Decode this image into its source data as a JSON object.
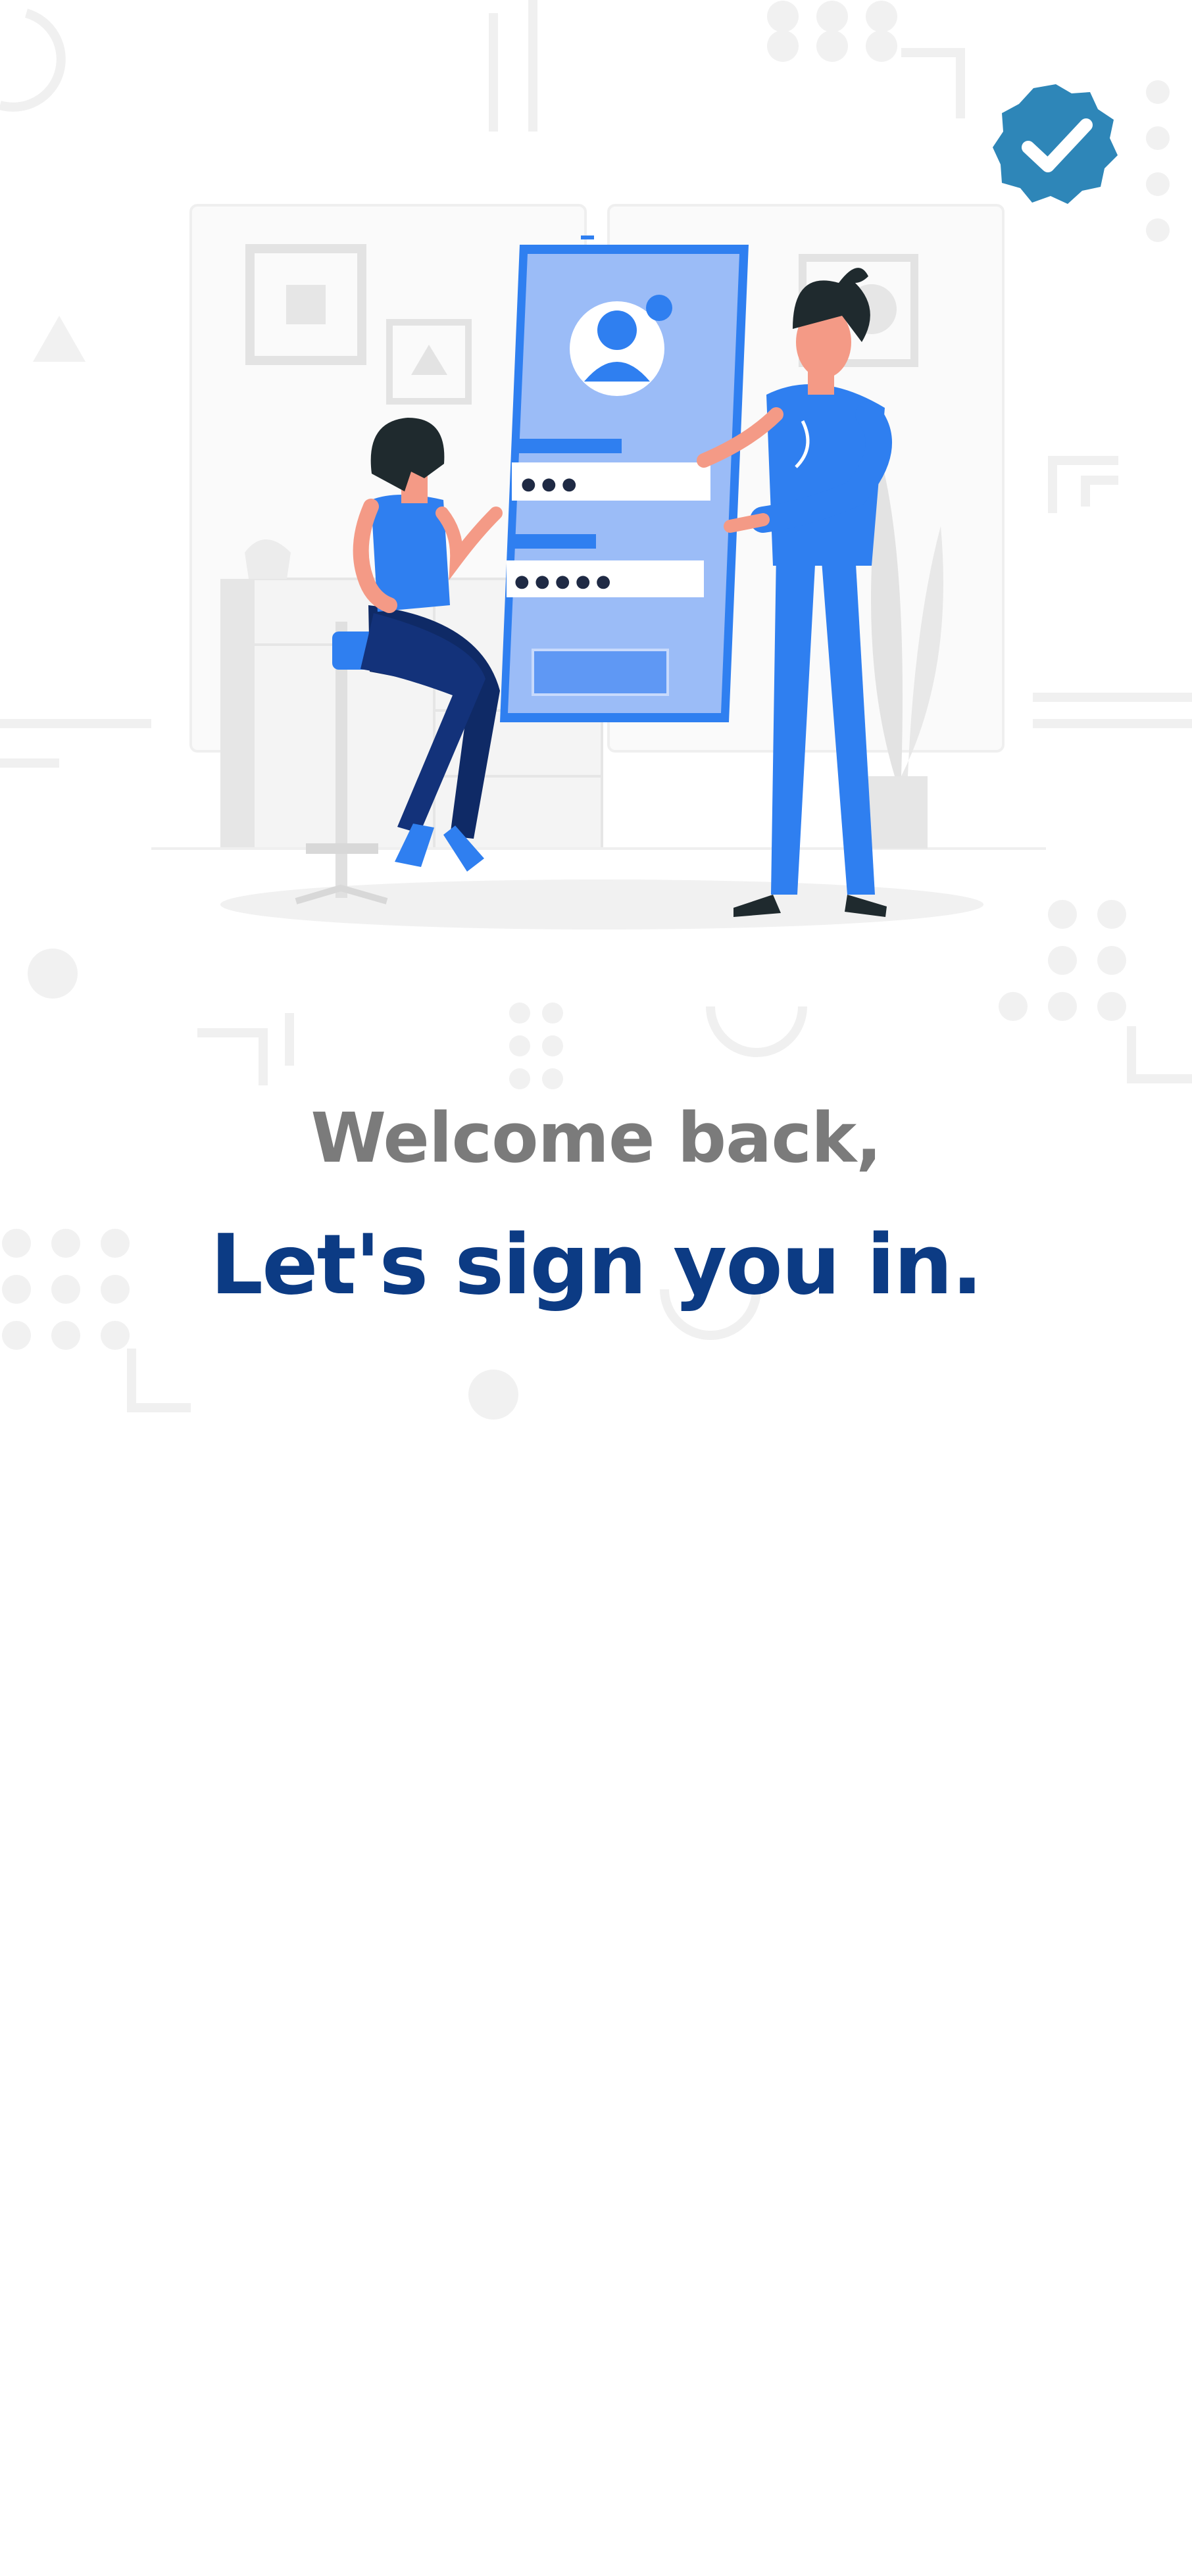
{
  "header": {
    "verified_badge_icon": "verified-check-icon",
    "badge_color": "#2e86b8"
  },
  "illustration": {
    "icon": "login-illustration",
    "accent_color": "#2f7ff0",
    "dark_color": "#0f2a66",
    "password_dots_1": "● ● ●",
    "password_dots_2": "● ● ● ● ●"
  },
  "main": {
    "welcome_text": "Welcome back,",
    "signin_text": "Let's sign you in."
  }
}
